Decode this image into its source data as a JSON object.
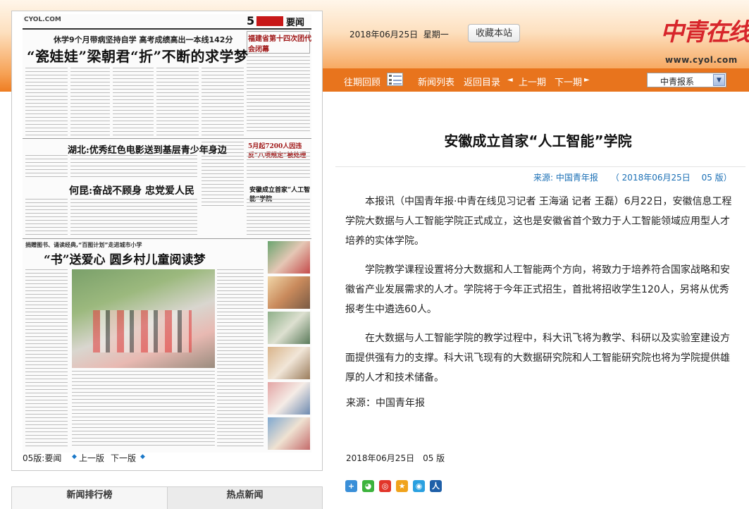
{
  "header": {
    "date": "2018年06月25日",
    "weekday": "星期一",
    "favorite_label": "收藏本站",
    "brand_name": "中青在线",
    "brand_url": "www.cyol.com"
  },
  "nav": {
    "archive": "往期回顾",
    "news_list": "新闻列表",
    "back_to_index": "返回目录",
    "prev_issue": "上一期",
    "next_issue": "下一期",
    "prev_arrow": "◄",
    "next_arrow": "►",
    "select_value": "中青报系",
    "select_arrow": "▼"
  },
  "colors": {
    "accent_orange": "#e8741d",
    "brand_red": "#d7262b",
    "link_blue": "#1a6fb5"
  },
  "paper": {
    "logo": "CYOL.COM",
    "page_num": "5",
    "section": "要闻",
    "subtitle": "休学9个月带病坚持自学 高考成绩高出一本线142分",
    "headline": "“瓷娃娃”梁朝君“折”不断的求学梦",
    "side_headline": "福建省第十四次团代会闭幕",
    "headline2": "湖北:优秀红色电影送到基层青少年身边",
    "headline3": "何昆:奋战不顾身 忠党爱人民",
    "side_headline2": "5月起7200人因违反“八项规定”被处理",
    "side_headline3": "安徽成立首家“人工智能”学院",
    "kicker4": "捐赠图书、诵读经典,“百图计划”走进城市小学",
    "headline4": "“书”送爱心 圆乡村儿童阅读梦",
    "page_label": "05版:要闻",
    "prev_page": "上一版",
    "next_page": "下一版",
    "arrow": "◆"
  },
  "tabs": {
    "ranking": "新闻排行榜",
    "hot": "热点新闻"
  },
  "article": {
    "title": "安徽成立首家“人工智能”学院",
    "meta": "来源: 中国青年报　　（ 2018年06月25日　 05 版）",
    "paragraphs": [
      "本报讯（中国青年报·中青在线见习记者 王海涵 记者 王磊）6月22日，安徽信息工程学院大数据与人工智能学院正式成立，这也是安徽省首个致力于人工智能领域应用型人才培养的实体学院。",
      "学院教学课程设置将分大数据和人工智能两个方向，将致力于培养符合国家战略和安徽省产业发展需求的人才。学院将于今年正式招生，首批将招收学生120人，另将从优秀报考生中遴选60人。",
      "在大数据与人工智能学院的教学过程中，科大讯飞将为教学、科研以及实验室建设方面提供强有力的支撑。科大讯飞现有的大数据研究院和人工智能研究院也将为学院提供雄厚的人才和技术储备。"
    ],
    "source": "来源：中国青年报",
    "footer": "2018年06月25日　05 版"
  },
  "share": {
    "icons": [
      {
        "name": "share-more-icon",
        "glyph": "+",
        "color": "#3a8fd8"
      },
      {
        "name": "wechat-icon",
        "glyph": "◕",
        "color": "#3db33d"
      },
      {
        "name": "weibo-icon",
        "glyph": "◎",
        "color": "#e2352a"
      },
      {
        "name": "qzone-icon",
        "glyph": "★",
        "color": "#f0a31c"
      },
      {
        "name": "tencent-weibo-icon",
        "glyph": "◉",
        "color": "#2aa0e0"
      },
      {
        "name": "renren-icon",
        "glyph": "人",
        "color": "#1e5fa8"
      }
    ]
  }
}
